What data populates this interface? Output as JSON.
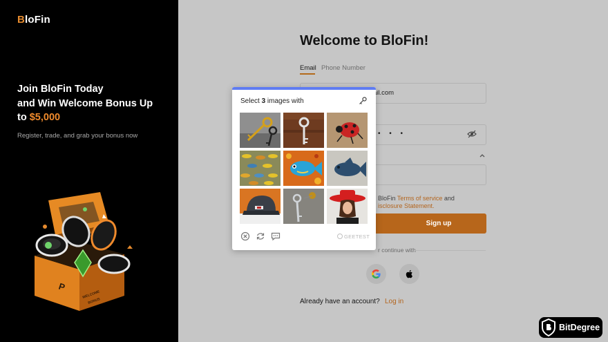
{
  "brand": {
    "logo_prefix": "B",
    "logo_rest": "loFin"
  },
  "promo": {
    "title_line1": "Join BloFin Today",
    "title_line2": "and Win Welcome Bonus Up",
    "title_to": "to ",
    "title_amount": "$5,000",
    "subtitle": "Register, trade, and grab your bonus now"
  },
  "form": {
    "welcome": "Welcome to BloFin!",
    "tabs": [
      {
        "label": "Email"
      },
      {
        "label": "Phone Number"
      }
    ],
    "email_value_partial": "ail.com",
    "password_mask": "• • •",
    "terms_prefix": "BloFin ",
    "terms_link": "Terms of service",
    "terms_and": " and",
    "disclosure_link": "isclosure Statement.",
    "signup_label": "Sign up",
    "continue_text": "r continue with",
    "have_account": "Already have an account?",
    "login_label": "Log in"
  },
  "captcha": {
    "title_prefix": "Select ",
    "title_count": "3",
    "title_suffix": " images with",
    "brand": "GEETEST",
    "tiles": [
      {
        "subject": "keys"
      },
      {
        "subject": "key"
      },
      {
        "subject": "ladybug"
      },
      {
        "subject": "fish-school"
      },
      {
        "subject": "fish"
      },
      {
        "subject": "fish"
      },
      {
        "subject": "cap"
      },
      {
        "subject": "key"
      },
      {
        "subject": "red-hat"
      }
    ]
  },
  "watermark": {
    "text": "BitDegree"
  },
  "colors": {
    "accent": "#b7661b",
    "captcha_bar": "#5f7cf2",
    "promo_amount": "#ef8a2c"
  }
}
